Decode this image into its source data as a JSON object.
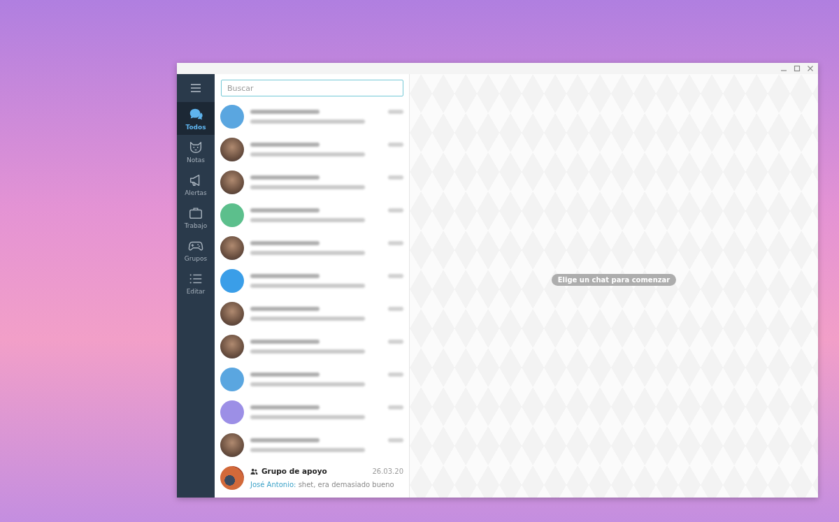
{
  "sidebar": {
    "folders": [
      {
        "label": "Todos",
        "selected": true
      },
      {
        "label": "Notas",
        "selected": false
      },
      {
        "label": "Alertas",
        "selected": false
      },
      {
        "label": "Trabajo",
        "selected": false
      },
      {
        "label": "Grupos",
        "selected": false
      },
      {
        "label": "Editar",
        "selected": false
      }
    ]
  },
  "search": {
    "placeholder": "Buscar"
  },
  "chats": [
    {
      "kind": "blurred_color",
      "color": "#5aa6e0"
    },
    {
      "kind": "blurred_photo"
    },
    {
      "kind": "blurred_photo"
    },
    {
      "kind": "blurred_color",
      "color": "#5cbf8c"
    },
    {
      "kind": "blurred_photo"
    },
    {
      "kind": "blurred_color",
      "color": "#3a9ee8"
    },
    {
      "kind": "blurred_photo"
    },
    {
      "kind": "blurred_photo"
    },
    {
      "kind": "blurred_color",
      "color": "#5aa6e0"
    },
    {
      "kind": "blurred_color",
      "color": "#9c8fe6"
    },
    {
      "kind": "blurred_photo"
    },
    {
      "kind": "group",
      "name": "Grupo de apoyo",
      "date": "26.03.20",
      "sender": "José Antonio:",
      "text": "shet, era demasiado bueno"
    }
  ],
  "empty_state": {
    "message": "Elige un chat para comenzar"
  }
}
